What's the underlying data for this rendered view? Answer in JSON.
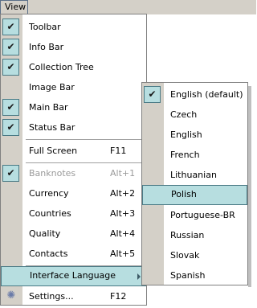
{
  "menubar": {
    "view_label": "View"
  },
  "view_menu": {
    "items": [
      {
        "label": "Toolbar",
        "checked": true
      },
      {
        "label": "Info Bar",
        "checked": true
      },
      {
        "label": "Collection Tree",
        "checked": true
      },
      {
        "label": "Image Bar",
        "checked": false
      },
      {
        "label": "Main Bar",
        "checked": true
      },
      {
        "label": "Status Bar",
        "checked": true
      },
      {
        "label": "Full Screen",
        "shortcut": "F11"
      },
      {
        "label": "Banknotes",
        "shortcut": "Alt+1",
        "checked": true,
        "disabled": true
      },
      {
        "label": "Currency",
        "shortcut": "Alt+2"
      },
      {
        "label": "Countries",
        "shortcut": "Alt+3"
      },
      {
        "label": "Quality",
        "shortcut": "Alt+4"
      },
      {
        "label": "Contacts",
        "shortcut": "Alt+5"
      },
      {
        "label": "Interface Language",
        "highlighted": true,
        "submenu": true
      },
      {
        "label": "Settings...",
        "shortcut": "F12",
        "icon": "gear-icon"
      }
    ]
  },
  "language_menu": {
    "items": [
      {
        "label": "English (default)",
        "checked": true
      },
      {
        "label": "Czech"
      },
      {
        "label": "English"
      },
      {
        "label": "French"
      },
      {
        "label": "Lithuanian"
      },
      {
        "label": "Polish",
        "highlighted": true
      },
      {
        "label": "Portuguese-BR"
      },
      {
        "label": "Russian"
      },
      {
        "label": "Slovak"
      },
      {
        "label": "Spanish"
      }
    ]
  },
  "colors": {
    "menu_bar": "#d4d0c8",
    "highlight": "#b7dee0",
    "highlight_border": "#4a7a85",
    "disabled_text": "#9a9a9a"
  }
}
